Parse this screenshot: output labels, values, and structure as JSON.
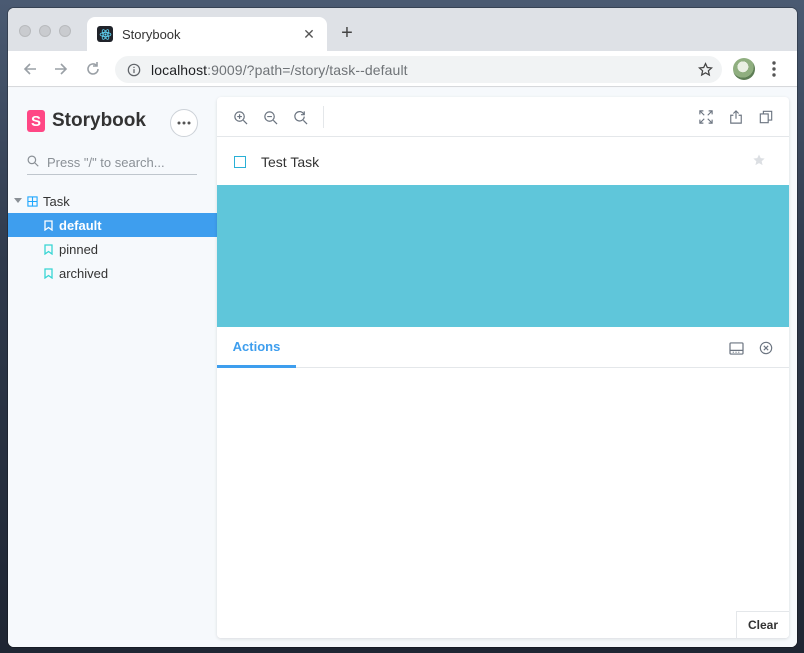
{
  "browser": {
    "tab_title": "Storybook",
    "tab_favicon": "react-icon",
    "url_host": "localhost",
    "url_rest": ":9009/?path=/story/task--default"
  },
  "sidebar": {
    "brand": "Storybook",
    "brand_mark": "S",
    "search_placeholder": "Press \"/\" to search...",
    "group": {
      "label": "Task"
    },
    "stories": [
      {
        "label": "default",
        "selected": true
      },
      {
        "label": "pinned",
        "selected": false
      },
      {
        "label": "archived",
        "selected": false
      }
    ]
  },
  "preview": {
    "task_title": "Test Task",
    "canvas_color": "#5fc6da"
  },
  "addons": {
    "active_tab": "Actions",
    "clear_label": "Clear"
  },
  "colors": {
    "accent": "#3e9eee",
    "brand": "#ff4785"
  }
}
